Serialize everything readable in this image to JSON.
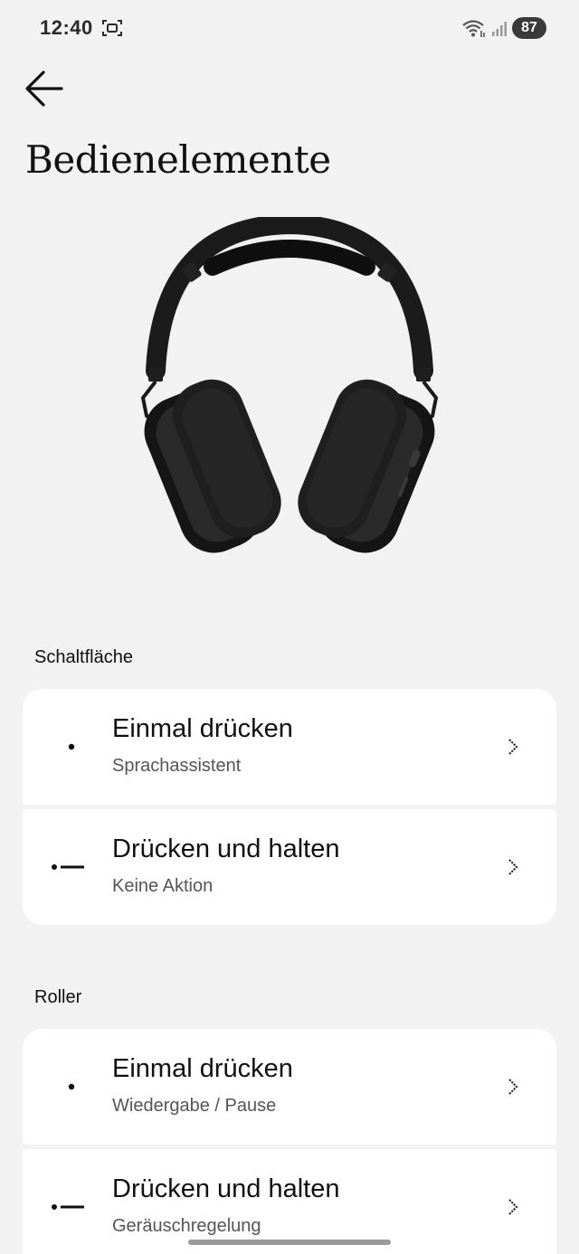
{
  "status_bar": {
    "time": "12:40",
    "battery": "87",
    "icons": [
      "screenshot-icon",
      "wifi-icon",
      "signal-icon"
    ]
  },
  "header": {
    "back_icon": "back-arrow-icon",
    "title": "Bedienelemente"
  },
  "product_image": "headphones",
  "sections": [
    {
      "label": "Schaltfläche",
      "rows": [
        {
          "gesture_icon": "single-press-icon",
          "title": "Einmal drücken",
          "subtitle": "Sprachassistent"
        },
        {
          "gesture_icon": "press-and-hold-icon",
          "title": "Drücken und halten",
          "subtitle": "Keine Aktion"
        }
      ]
    },
    {
      "label": "Roller",
      "rows": [
        {
          "gesture_icon": "single-press-icon",
          "title": "Einmal drücken",
          "subtitle": "Wiedergabe / Pause"
        },
        {
          "gesture_icon": "press-and-hold-icon",
          "title": "Drücken und halten",
          "subtitle": "Geräuschregelung"
        }
      ]
    }
  ],
  "colors": {
    "background": "#f2f2f2",
    "card": "#ffffff",
    "text_primary": "#111111",
    "text_secondary": "#555555"
  }
}
